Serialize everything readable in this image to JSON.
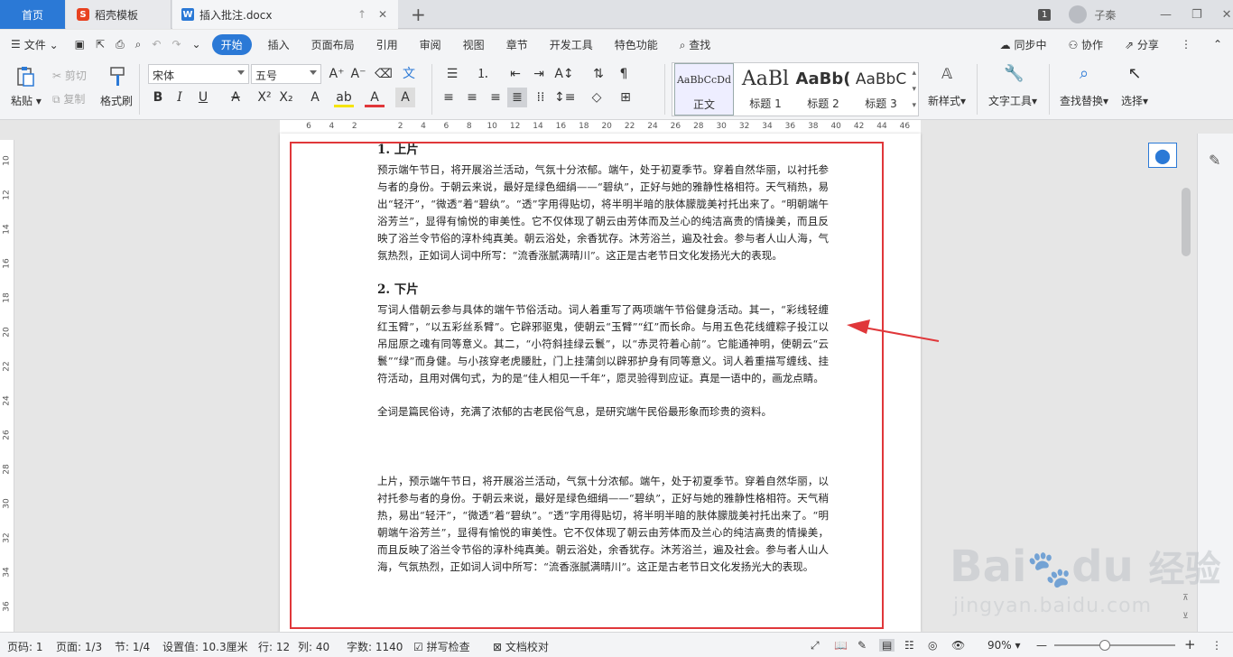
{
  "titlebar": {
    "tabs": [
      {
        "label": "首页"
      },
      {
        "label": "稻壳模板"
      },
      {
        "label": "插入批注.docx"
      }
    ],
    "badge": "1",
    "user": "子秦"
  },
  "menu": {
    "file": "文件",
    "items": [
      "开始",
      "插入",
      "页面布局",
      "引用",
      "审阅",
      "视图",
      "章节",
      "开发工具",
      "特色功能"
    ],
    "search": "查找",
    "sync": "同步中",
    "collab": "协作",
    "share": "分享"
  },
  "ribbon": {
    "paste": "粘贴",
    "cut": "剪切",
    "copy": "复制",
    "format_painter": "格式刷",
    "font": "宋体",
    "size": "五号",
    "styles": [
      {
        "preview": "AaBbCcDd",
        "name": "正文"
      },
      {
        "preview": "AaBl",
        "name": "标题 1"
      },
      {
        "preview": "AaBb(",
        "name": "标题 2"
      },
      {
        "preview": "AaBbC",
        "name": "标题 3"
      }
    ],
    "new_style": "新样式",
    "text_tools": "文字工具",
    "find_replace": "查找替换",
    "select": "选择"
  },
  "ruler": {
    "h": [
      "6",
      "4",
      "2",
      "",
      "2",
      "4",
      "6",
      "8",
      "10",
      "12",
      "14",
      "16",
      "18",
      "20",
      "22",
      "24",
      "26",
      "28",
      "30",
      "32",
      "34",
      "36",
      "38",
      "40",
      "42",
      "44",
      "46"
    ],
    "v": [
      "10",
      "12",
      "14",
      "16",
      "18",
      "20",
      "22",
      "24",
      "26",
      "28",
      "30",
      "32",
      "34",
      "36"
    ]
  },
  "doc": {
    "h1": "1.  上片",
    "p1": "预示端午节日，将开展浴兰活动，气氛十分浓郁。端午，处于初夏季节。穿着自然华丽，以衬托参与者的身份。于朝云来说，最好是绿色细绢——“碧纨”，正好与她的雅静性格相符。天气稍热，易出“轻汗”，“微透”着“碧纨”。“透”字用得贴切，将半明半暗的肤体朦胧美衬托出来了。“明朝端午浴芳兰”，显得有愉悦的审美性。它不仅体现了朝云由芳体而及兰心的纯洁高贵的情操美，而且反映了浴兰令节俗的淳朴纯真美。朝云浴处，余香犹存。沐芳浴兰，遍及社会。参与者人山人海，气氛热烈，正如词人词中所写：“流香涨腻满晴川”。这正是古老节日文化发扬光大的表现。",
    "h2": "2.  下片",
    "p2": "写词人借朝云参与具体的端午节俗活动。词人着重写了两项端午节俗健身活动。其一，“彩线轻缠红玉臂”，“以五彩丝系臂”。它辟邪驱鬼，使朝云“玉臂”“红”而长命。与用五色花线缠粽子投江以吊屈原之魂有同等意义。其二，“小符斜挂绿云鬟”，以“赤灵符着心前”。它能通神明，使朝云“云鬟”“绿”而身健。与小孩穿老虎腰肚，门上挂蒲剑以辟邪护身有同等意义。词人着重描写缠线、挂符活动，且用对偶句式，为的是“佳人相见一千年”，愿灵验得到应证。真是一语中的，画龙点睛。",
    "p3": "全词是篇民俗诗，充满了浓郁的古老民俗气息，是研究端午民俗最形象而珍贵的资料。",
    "p4": "上片，预示端午节日，将开展浴兰活动，气氛十分浓郁。端午，处于初夏季节。穿着自然华丽，以衬托参与者的身份。于朝云来说，最好是绿色细绢——“碧纨”，正好与她的雅静性格相符。天气稍热，易出“轻汗”，“微透”着“碧纨”。“透”字用得贴切，将半明半暗的肤体朦胧美衬托出来了。“明朝端午浴芳兰”，显得有愉悦的审美性。它不仅体现了朝云由芳体而及兰心的纯洁高贵的情操美，而且反映了浴兰令节俗的淳朴纯真美。朝云浴处，余香犹存。沐芳浴兰，遍及社会。参与者人山人海，气氛热烈，正如词人词中所写：“流香涨腻满晴川”。这正是古老节日文化发扬光大的表现。"
  },
  "status": {
    "page": "页码: 1",
    "pages": "页面: 1/3",
    "section": "节: 1/4",
    "setting": "设置值: 10.3厘米",
    "row": "行: 12",
    "col": "列: 40",
    "words": "字数: 1140",
    "spell": "拼写检查",
    "proof": "文档校对",
    "zoom": "90%"
  },
  "watermark": {
    "brand": "Bai",
    "paw": "du",
    "cn": "经验",
    "url": "jingyan.baidu.com"
  },
  "colors": {
    "accent": "#2b79d6",
    "annotation": "#e0373a"
  }
}
